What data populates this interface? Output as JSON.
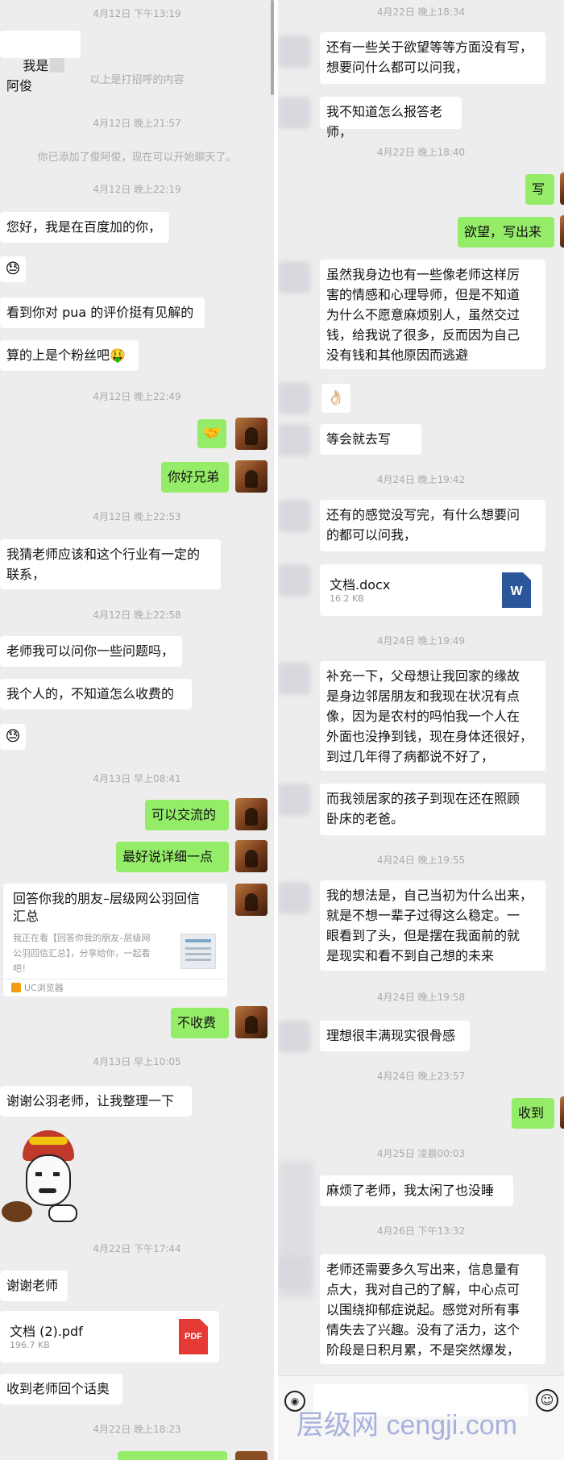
{
  "left_chat": {
    "ts1": "4月12日 下午13:19",
    "msg_intro_prefix": "我是",
    "msg_intro_name": "阿俊",
    "sys_greeting": "以上是打招呼的内容",
    "ts2": "4月12日 晚上21:57",
    "sys_added": "你已添加了俊阿俊，现在可以开始聊天了。",
    "ts3": "4月12日 晚上22:19",
    "msg_baidu": "您好，我是在百度加的你，",
    "msg_pua": "看到你对 pua 的评价挺有见解的",
    "msg_fan": "算的上是个粉丝吧🤑",
    "ts4": "4月12日 晚上22:49",
    "msg_hello": "你好兄弟",
    "ts5": "4月12日 晚上22:53",
    "msg_guess": "我猜老师应该和这个行业有一定的\n联系，",
    "ts6": "4月12日 晚上22:58",
    "msg_ask": "老师我可以问你一些问题吗，",
    "msg_personal": "我个人的，不知道怎么收费的",
    "ts7": "4月13日 早上08:41",
    "msg_can": "可以交流的",
    "msg_detail": "最好说详细一点",
    "link_title": "回答你我的朋友–层级网公羽回信\n汇总",
    "link_desc": "我正在看【回答你我的朋友–层级网\n公羽回信汇总】，分享给你，一起看\n吧！",
    "link_source": "UC浏览器",
    "msg_free": "不收费",
    "ts8": "4月13日 早上10:05",
    "msg_thanks_gy": "谢谢公羽老师，让我整理一下",
    "ts9": "4月22日 下午17:44",
    "msg_thanks": "谢谢老师",
    "pdf_name": "文档 (2).pdf",
    "pdf_size": "196.7 KB",
    "pdf_label": "PDF",
    "msg_topic": "收到老师回个话奥",
    "ts10": "4月22日 晚上18:23"
  },
  "right_chat": {
    "ts1": "4月22日 晚上18:34",
    "msg_desire": "还有一些关于欲望等等方面没有写，\n想要问什么都可以问我，",
    "msg_repay": "我不知道怎么报答老师，",
    "ts2": "4月22日 晚上18:40",
    "msg_write": "写",
    "msg_write_desire": "欲望，写出来",
    "msg_mentor": "虽然我身边也有一些像老师这样厉\n害的情感和心理导师，但是不知道\n为什么不愿意麻烦别人，虽然交过\n钱，给我说了很多，反而因为自己\n没有钱和其他原因而逃避",
    "msg_ok_emoji": "👌🏻",
    "msg_later": "等会就去写",
    "ts3": "4月24日 晚上19:42",
    "msg_unfinished": "还有的感觉没写完，有什么想要问\n的都可以问我，",
    "doc_name": "文档.docx",
    "doc_size": "16.2 KB",
    "doc_label": "W",
    "ts4": "4月24日 晚上19:49",
    "msg_parents": "补充一下，父母想让我回家的缘故\n是身边邻居朋友和我现在状况有点\n像，因为是农村的吗怕我一个人在\n外面也没挣到钱，现在身体还很好，\n到过几年得了病都说不好了，",
    "msg_neighbor": "而我领居家的孩子到现在还在照顾\n卧床的老爸。",
    "ts5": "4月24日 晚上19:55",
    "msg_thoughts": "我的想法是，自己当初为什么出来，\n就是不想一辈子过得这么稳定。一\n眼看到了头，但是摆在我面前的就\n是现实和看不到自己想的未来",
    "ts6": "4月24日 晚上19:58",
    "msg_ideal": "理想很丰满现实很骨感",
    "ts7": "4月24日 晚上23:57",
    "msg_received": "收到",
    "ts8": "4月25日 凌晨00:03",
    "msg_trouble": "麻烦了老师，我太闲了也没睡",
    "ts9": "4月26日 下午13:32",
    "msg_long": "老师还需要多久写出来，信息量有\n点大，我对自己的了解，中心点可\n以围绕抑郁症说起。感觉对所有事\n情失去了兴趣。没有了活力，这个\n阶段是日积月累，不是突然爆发，"
  },
  "input_bar": {
    "voice_icon": "voice-icon",
    "emoji_icon": "emoji-icon",
    "voice_glyph": "◉",
    "emoji_glyph": "☺"
  },
  "watermark": "层级网 cengji.com",
  "colors": {
    "chat_bg": "#ededed",
    "sent_bubble": "#95ec69",
    "received_bubble": "#ffffff",
    "timestamp": "#aaaaaa"
  }
}
